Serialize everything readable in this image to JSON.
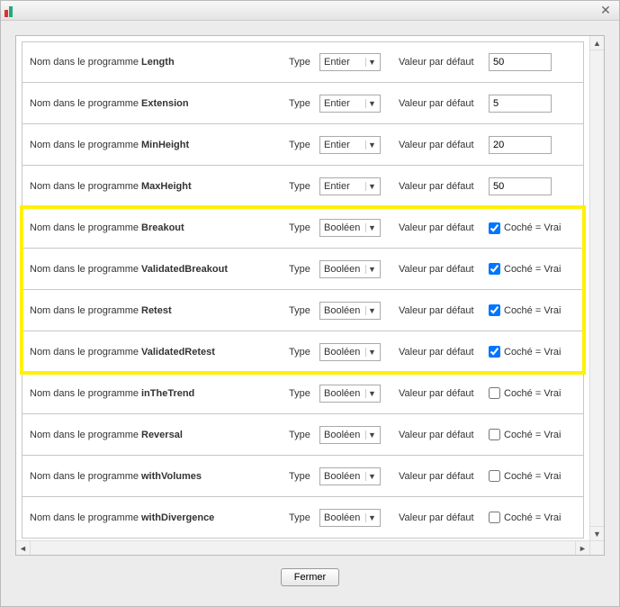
{
  "labels": {
    "name": "Nom dans le programme",
    "type": "Type",
    "default": "Valeur par défaut",
    "checked": "Coché = Vrai",
    "close": "Fermer"
  },
  "type_options": {
    "int": "Entier",
    "bool": "Booléen"
  },
  "rows": [
    {
      "name": "Length",
      "type": "int",
      "default": "50",
      "checked": false,
      "hl": false
    },
    {
      "name": "Extension",
      "type": "int",
      "default": "5",
      "checked": false,
      "hl": false
    },
    {
      "name": "MinHeight",
      "type": "int",
      "default": "20",
      "checked": false,
      "hl": false
    },
    {
      "name": "MaxHeight",
      "type": "int",
      "default": "50",
      "checked": false,
      "hl": false
    },
    {
      "name": "Breakout",
      "type": "bool",
      "default": "",
      "checked": true,
      "hl": true
    },
    {
      "name": "ValidatedBreakout",
      "type": "bool",
      "default": "",
      "checked": true,
      "hl": true
    },
    {
      "name": "Retest",
      "type": "bool",
      "default": "",
      "checked": true,
      "hl": true
    },
    {
      "name": "ValidatedRetest",
      "type": "bool",
      "default": "",
      "checked": true,
      "hl": true
    },
    {
      "name": "inTheTrend",
      "type": "bool",
      "default": "",
      "checked": false,
      "hl": false
    },
    {
      "name": "Reversal",
      "type": "bool",
      "default": "",
      "checked": false,
      "hl": false
    },
    {
      "name": "withVolumes",
      "type": "bool",
      "default": "",
      "checked": false,
      "hl": false
    },
    {
      "name": "withDivergence",
      "type": "bool",
      "default": "",
      "checked": false,
      "hl": false
    }
  ]
}
